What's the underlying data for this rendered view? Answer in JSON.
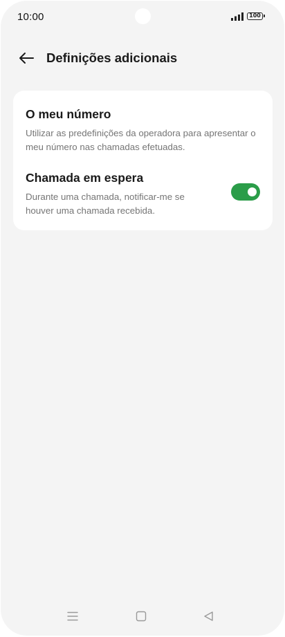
{
  "status_bar": {
    "time": "10:00",
    "battery": "100",
    "icons": [
      "signal-icon",
      "battery-icon",
      "camera-cutout"
    ]
  },
  "header": {
    "back_icon": "arrow-left-icon",
    "title": "Definições adicionais"
  },
  "settings": [
    {
      "title": "O meu número",
      "description": "Utilizar as predefinições da operadora para apresentar o meu número nas chamadas efetuadas."
    },
    {
      "title": "Chamada em espera",
      "description": "Durante uma chamada, notificar-me se houver uma chamada recebida.",
      "toggle_on": true
    }
  ],
  "nav_bar": {
    "icons": [
      "menu-icon",
      "home-icon",
      "back-triangle-icon"
    ]
  },
  "colors": {
    "background": "#f4f4f4",
    "card": "#ffffff",
    "accent_toggle": "#2b9d49",
    "title_text": "#1a1a1a",
    "secondary_text": "#757575"
  }
}
